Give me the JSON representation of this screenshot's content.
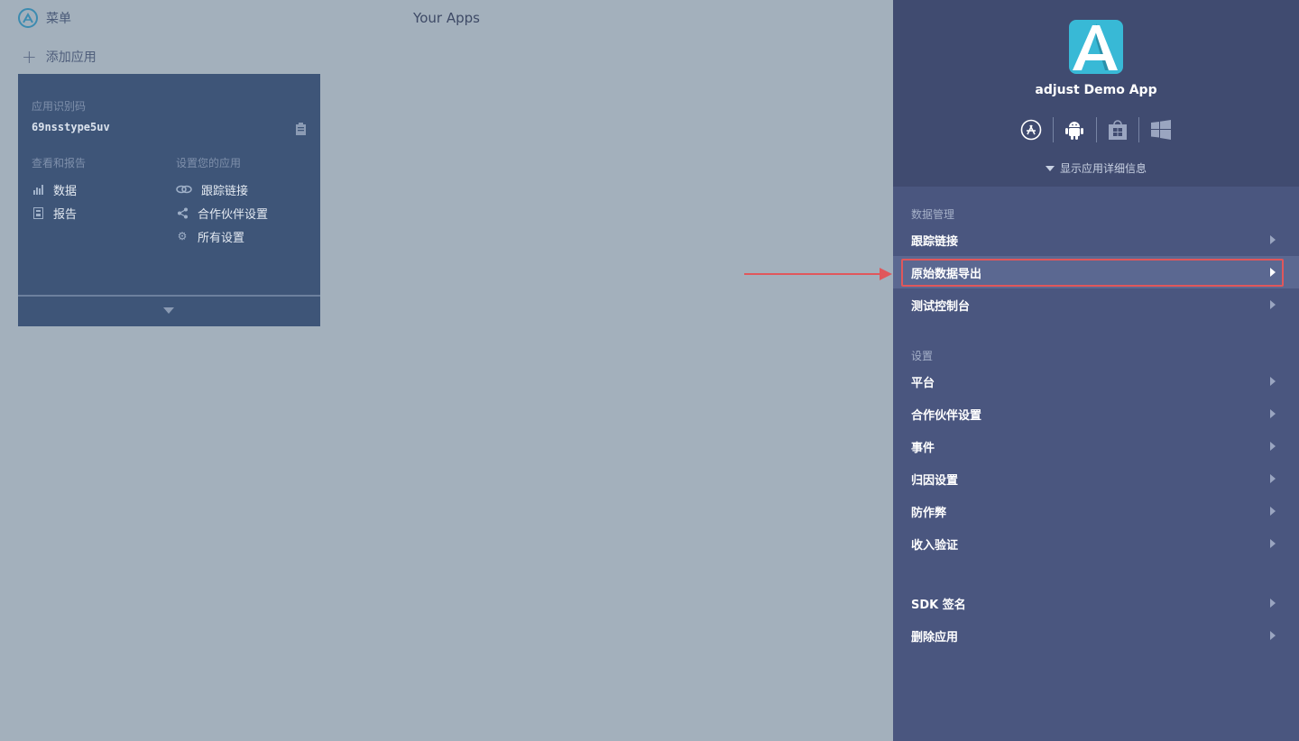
{
  "topbar": {
    "menu_label": "菜单",
    "title": "Your Apps",
    "add_app_label": "添加应用"
  },
  "card": {
    "app_id_label": "应用识别码",
    "app_id": "69nsstype5uv",
    "view_section": "查看和报告",
    "setup_section": "设置您的应用",
    "view_items": [
      {
        "label": "数据",
        "icon": "bar-chart-icon"
      },
      {
        "label": "报告",
        "icon": "report-icon"
      }
    ],
    "setup_items": [
      {
        "label": "跟踪链接",
        "icon": "link-icon"
      },
      {
        "label": "合作伙伴设置",
        "icon": "share-icon"
      },
      {
        "label": "所有设置",
        "icon": "gear-icon"
      }
    ]
  },
  "panel": {
    "app_name": "adjust Demo App",
    "platforms": [
      "app-store-icon",
      "android-icon",
      "windows-store-icon",
      "windows-icon"
    ],
    "show_details": "显示应用详细信息",
    "data_section": "数据管理",
    "data_items": [
      "跟踪链接",
      "原始数据导出",
      "测试控制台"
    ],
    "settings_section": "设置",
    "settings_items": [
      "平台",
      "合作伙伴设置",
      "事件",
      "归因设置",
      "防作弊",
      "收入验证"
    ],
    "other_items": [
      "SDK 签名",
      "删除应用"
    ],
    "highlighted_item": "原始数据导出"
  },
  "colors": {
    "highlight": "#e0575b",
    "panel": "#4a567f",
    "panel_head": "#404b70",
    "card": "#3e5578",
    "background": "#a3b0bc",
    "logo": "#38b9d6"
  }
}
